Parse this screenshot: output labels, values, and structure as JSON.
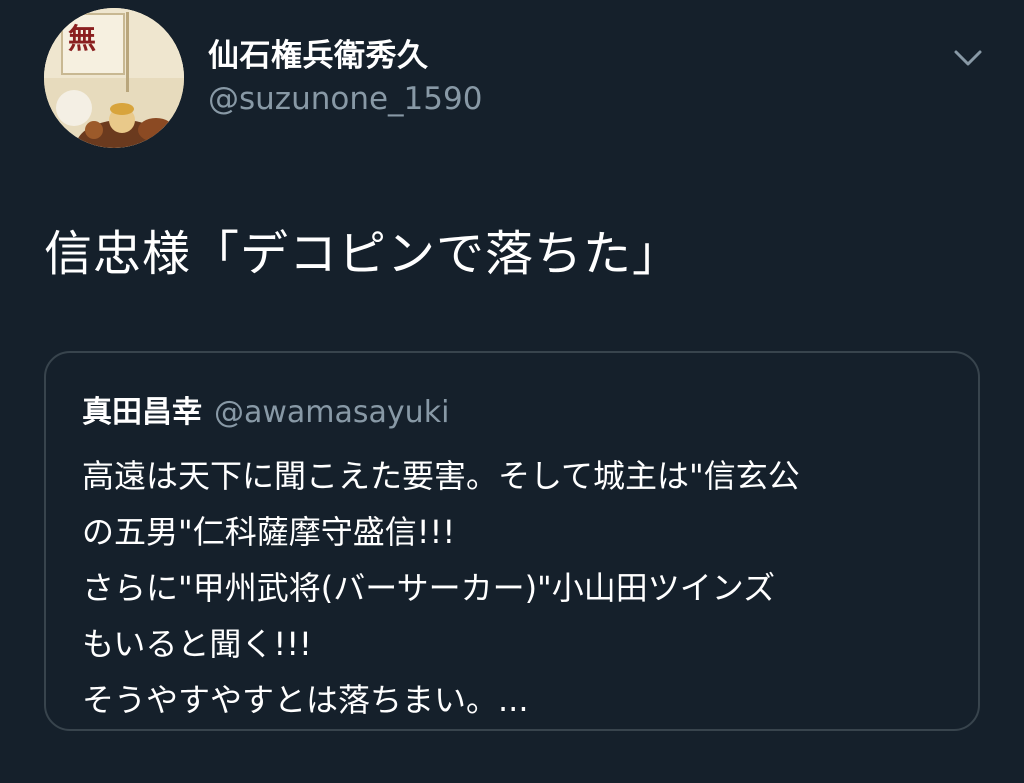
{
  "tweet": {
    "display_name": "仙石権兵衛秀久",
    "handle": "@suzunone_1590",
    "text": "信忠様「デコピンで落ちた」"
  },
  "quoted_tweet": {
    "display_name": "真田昌幸",
    "handle": "@awamasayuki",
    "lines": [
      "高遠は天下に聞こえた要害。そして城主は\"信玄公",
      "の五男\"仁科薩摩守盛信!!!",
      "さらに\"甲州武将(バーサーカー)\"小山田ツインズ",
      "もいると聞く!!!",
      "そうやすやすとは落ちまい。..."
    ]
  },
  "icons": {
    "avatar": "avatar-image",
    "caret": "chevron-down-icon"
  },
  "colors": {
    "background": "#15202b",
    "primary_text": "#ffffff",
    "secondary_text": "#8899a6",
    "border": "#38444d"
  }
}
